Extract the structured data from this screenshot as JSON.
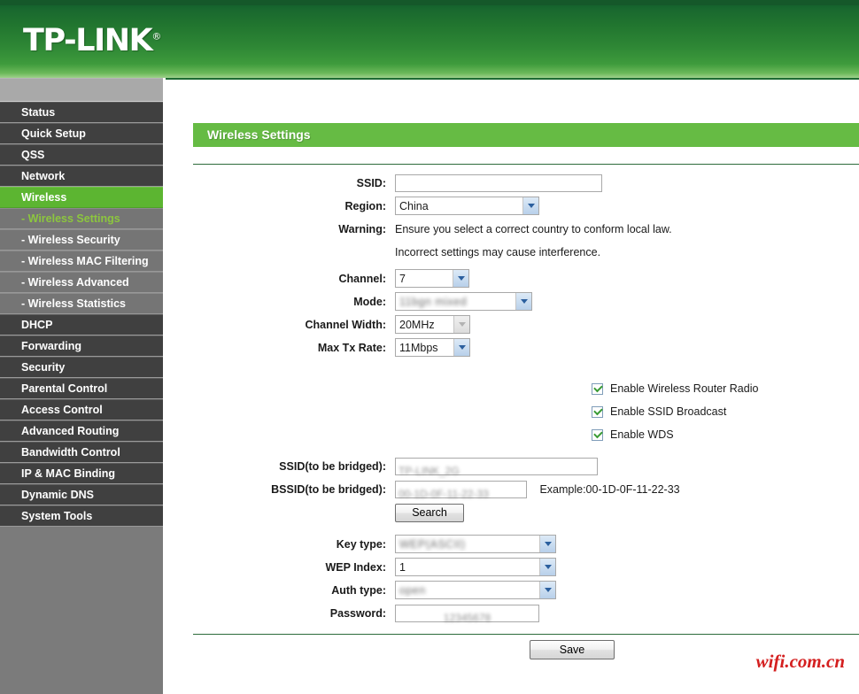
{
  "brand": {
    "name": "TP-LINK",
    "registered_mark": "®"
  },
  "sidebar": {
    "items": [
      {
        "label": "Status",
        "type": "main",
        "state": "normal"
      },
      {
        "label": "Quick Setup",
        "type": "main",
        "state": "normal"
      },
      {
        "label": "QSS",
        "type": "main",
        "state": "normal"
      },
      {
        "label": "Network",
        "type": "main",
        "state": "normal"
      },
      {
        "label": "Wireless",
        "type": "main",
        "state": "active"
      },
      {
        "label": "- Wireless Settings",
        "type": "sub",
        "state": "active-sub"
      },
      {
        "label": "- Wireless Security",
        "type": "sub",
        "state": "normal"
      },
      {
        "label": "- Wireless MAC Filtering",
        "type": "sub",
        "state": "normal"
      },
      {
        "label": "- Wireless Advanced",
        "type": "sub",
        "state": "normal"
      },
      {
        "label": "- Wireless Statistics",
        "type": "sub",
        "state": "normal"
      },
      {
        "label": "DHCP",
        "type": "main",
        "state": "normal"
      },
      {
        "label": "Forwarding",
        "type": "main",
        "state": "normal"
      },
      {
        "label": "Security",
        "type": "main",
        "state": "normal"
      },
      {
        "label": "Parental Control",
        "type": "main",
        "state": "normal"
      },
      {
        "label": "Access Control",
        "type": "main",
        "state": "normal"
      },
      {
        "label": "Advanced Routing",
        "type": "main",
        "state": "normal"
      },
      {
        "label": "Bandwidth Control",
        "type": "main",
        "state": "normal"
      },
      {
        "label": "IP & MAC Binding",
        "type": "main",
        "state": "normal"
      },
      {
        "label": "Dynamic DNS",
        "type": "main",
        "state": "normal"
      },
      {
        "label": "System Tools",
        "type": "main",
        "state": "normal"
      }
    ]
  },
  "main": {
    "section_title": "Wireless Settings",
    "fields": {
      "ssid": {
        "label": "SSID:",
        "value": "",
        "placeholder": ""
      },
      "region": {
        "label": "Region:",
        "value": "China"
      },
      "warning": {
        "label": "Warning:",
        "line1": "Ensure you select a correct country to conform local law.",
        "line2": "Incorrect settings may cause interference."
      },
      "channel": {
        "label": "Channel:",
        "value": "7"
      },
      "mode": {
        "label": "Mode:",
        "value": "11bgn mixed",
        "redacted": true
      },
      "channel_width": {
        "label": "Channel Width:",
        "value": "20MHz",
        "disabled": true
      },
      "max_tx_rate": {
        "label": "Max Tx Rate:",
        "value": "11Mbps"
      },
      "enable_radio": {
        "label": "Enable Wireless Router Radio",
        "checked": true
      },
      "enable_ssid_broadcast": {
        "label": "Enable SSID Broadcast",
        "checked": true
      },
      "enable_wds": {
        "label": "Enable WDS",
        "checked": true
      },
      "ssid_bridged": {
        "label": "SSID(to be bridged):",
        "value": "TP-LINK_2G",
        "redacted": true
      },
      "bssid_bridged": {
        "label": "BSSID(to be bridged):",
        "value": "00-1D-0F-11-22-33",
        "redacted": true
      },
      "bssid_example": "Example:00-1D-0F-11-22-33",
      "search_button": "Search",
      "key_type": {
        "label": "Key type:",
        "value": "WEP(ASCII)",
        "redacted": true
      },
      "wep_index": {
        "label": "WEP Index:",
        "value": "1"
      },
      "auth_type": {
        "label": "Auth type:",
        "value": "open",
        "redacted": true
      },
      "password": {
        "label": "Password:",
        "value": "12345678",
        "redacted": true
      }
    },
    "save_button": "Save",
    "watermark": "wifi.com.cn"
  },
  "colors": {
    "brand_green": "#2e8735",
    "accent_green": "#5cb531",
    "banner_green": "#66bb44",
    "sidebar_dark": "#404040",
    "sidebar_sub": "#757575",
    "submenu_active_text": "#8cc63e",
    "watermark_red": "#d42020",
    "rule_green": "#2d6b3b"
  }
}
